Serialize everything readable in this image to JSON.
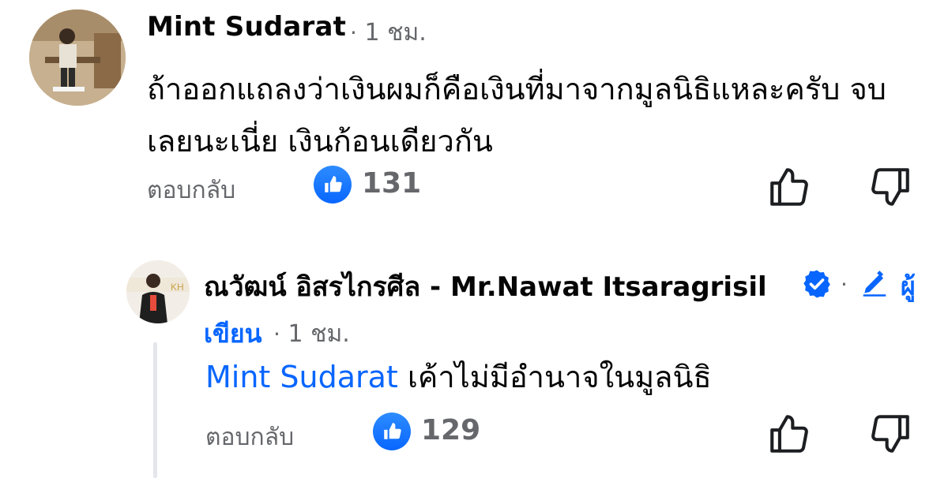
{
  "comments": [
    {
      "author": "Mint Sudarat",
      "separator": "·",
      "time": "1 ชม.",
      "text": "ถ้าออกแถลงว่าเงินผมก็คือเงินที่มาจากมูลนิธิแหละครับ จบเลยนะเนี่ย เงินก้อนเดียวกัน",
      "reply_label": "ตอบกลับ",
      "like_count": "131",
      "like_icon": "like-icon",
      "actions": [
        "thumbs-up-icon",
        "thumbs-down-icon"
      ]
    }
  ],
  "reply": {
    "author": "ณวัฒน์ อิสรไกรศีล - Mr.Nawat Itsaragrisil",
    "verified_icon": "verified-badge-icon",
    "separator": "·",
    "role_icon": "pencil-icon",
    "role_part1": "ผู้",
    "role_part2": "เขียน",
    "time": "1 ชม.",
    "mention": "Mint Sudarat",
    "text": " เค้าไม่มีอำนาจในมูลนิธิ",
    "reply_label": "ตอบกลับ",
    "like_count": "129",
    "actions": [
      "thumbs-up-icon",
      "thumbs-down-icon"
    ]
  },
  "colors": {
    "accent": "#0866ff",
    "secondary_text": "#65676b",
    "thread_line": "#e4e6eb"
  }
}
